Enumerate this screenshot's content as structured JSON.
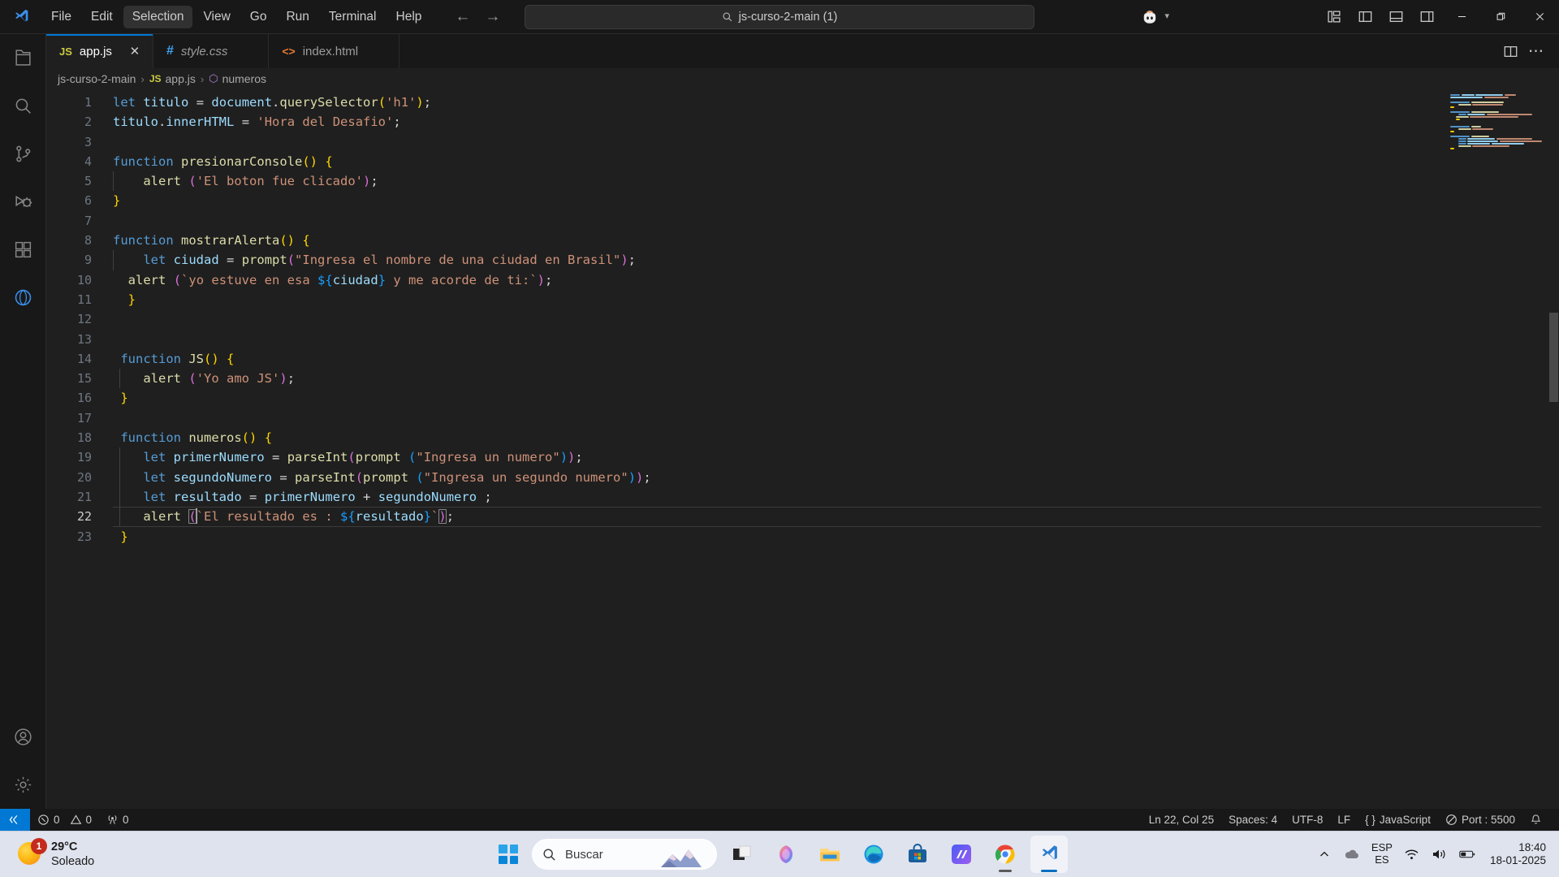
{
  "titlebar": {
    "menus": [
      "File",
      "Edit",
      "Selection",
      "View",
      "Go",
      "Run",
      "Terminal",
      "Help"
    ],
    "active_menu": "Selection",
    "back_arrow": "←",
    "forward_arrow": "→",
    "command_center_text": "js-curso-2-main (1)",
    "copilot_label": "copilot-icon",
    "layout_buttons": [
      "customize-layout",
      "toggle-primary-sidebar",
      "toggle-panel",
      "toggle-secondary-sidebar"
    ],
    "window_controls": [
      "minimize",
      "restore",
      "close"
    ]
  },
  "activitybar": {
    "items": [
      {
        "name": "explorer",
        "selected": false
      },
      {
        "name": "search",
        "selected": false
      },
      {
        "name": "source-control",
        "selected": false
      },
      {
        "name": "run-and-debug",
        "selected": false
      },
      {
        "name": "extensions",
        "selected": false
      },
      {
        "name": "live-preview",
        "selected": false
      }
    ],
    "bottom_items": [
      {
        "name": "accounts",
        "selected": false
      },
      {
        "name": "manage-settings",
        "selected": false
      }
    ]
  },
  "tabs": [
    {
      "label": "app.js",
      "icon": "js",
      "active": true,
      "preview": false,
      "close": "✕"
    },
    {
      "label": "style.css",
      "icon": "css",
      "active": false,
      "preview": true,
      "close": "✕"
    },
    {
      "label": "index.html",
      "icon": "html",
      "active": false,
      "preview": false,
      "close": "✕"
    }
  ],
  "editor_actions": [
    "split-editor-right",
    "more-actions"
  ],
  "breadcrumb": {
    "items": [
      "js-curso-2-main",
      "app.js",
      "numeros"
    ],
    "separator": "›",
    "file_icon": "JS",
    "symbol_icon": "⬡"
  },
  "code": {
    "language": "JavaScript",
    "lines": [
      {
        "n": 1,
        "indent": 0
      },
      {
        "n": 2,
        "indent": 0
      },
      {
        "n": 3,
        "indent": 0
      },
      {
        "n": 4,
        "indent": 0
      },
      {
        "n": 5,
        "indent": 1
      },
      {
        "n": 6,
        "indent": 0
      },
      {
        "n": 7,
        "indent": 0
      },
      {
        "n": 8,
        "indent": 0
      },
      {
        "n": 9,
        "indent": 1
      },
      {
        "n": 10,
        "indent": 1
      },
      {
        "n": 11,
        "indent": 1
      },
      {
        "n": 12,
        "indent": 0
      },
      {
        "n": 13,
        "indent": 0
      },
      {
        "n": 14,
        "indent": 0
      },
      {
        "n": 15,
        "indent": 1
      },
      {
        "n": 16,
        "indent": 0
      },
      {
        "n": 17,
        "indent": 0
      },
      {
        "n": 18,
        "indent": 0
      },
      {
        "n": 19,
        "indent": 1
      },
      {
        "n": 20,
        "indent": 1
      },
      {
        "n": 21,
        "indent": 1
      },
      {
        "n": 22,
        "indent": 1
      },
      {
        "n": 23,
        "indent": 0
      }
    ],
    "text": [
      "let titulo = document.querySelector('h1');",
      "titulo.innerHTML = 'Hora del Desafio';",
      "",
      "function presionarConsole() {",
      "    alert ('El boton fue clicado');",
      "}",
      "",
      "function mostrarAlerta() {",
      "    let ciudad = prompt(\"Ingresa el nombre de una ciudad en Brasil\");",
      "  alert (`yo estuve en esa ${ciudad} y me acorde de ti:`);",
      "  }",
      "",
      "",
      " function JS() {",
      "    alert ('Yo amo JS');",
      " }",
      "",
      " function numeros() {",
      "    let primerNumero = parseInt(prompt (\"Ingresa un numero\"));",
      "    let segundoNumero = parseInt(prompt (\"Ingresa un segundo numero\"));",
      "    let resultado = primerNumero + segundoNumero ;",
      "    alert (`El resultado es : ${resultado}`);",
      " }"
    ],
    "current_line": 22
  },
  "statusbar": {
    "remote_icon": "remote-window",
    "errors": "0",
    "warnings": "0",
    "ports_count": "0",
    "position": "Ln 22, Col 25",
    "indentation": "Spaces: 4",
    "encoding": "UTF-8",
    "eol": "LF",
    "language": "JavaScript",
    "live_server": "Port : 5500",
    "bell_icon": "notifications"
  },
  "taskbar": {
    "weather": {
      "temperature": "29°C",
      "condition": "Soleado",
      "badge": "1"
    },
    "search_placeholder": "Buscar",
    "pinned": [
      {
        "name": "task-view"
      },
      {
        "name": "copilot"
      },
      {
        "name": "file-explorer"
      },
      {
        "name": "microsoft-edge"
      },
      {
        "name": "microsoft-store"
      },
      {
        "name": "monica-app"
      },
      {
        "name": "google-chrome"
      },
      {
        "name": "visual-studio-code"
      }
    ],
    "tray": {
      "overflow": "∧",
      "cloud": "onedrive",
      "language_line1": "ESP",
      "language_line2": "ES",
      "wifi": "wifi",
      "volume": "volume",
      "battery": "battery",
      "time": "18:40",
      "date": "18-01-2025"
    }
  },
  "colors": {
    "accent": "#0078d4",
    "tab_active_border": "#0078d4",
    "error_red": "#c42b1c",
    "js_yellow": "#cbcb41",
    "css_blue": "#42a5f5",
    "html_orange": "#e37933"
  }
}
